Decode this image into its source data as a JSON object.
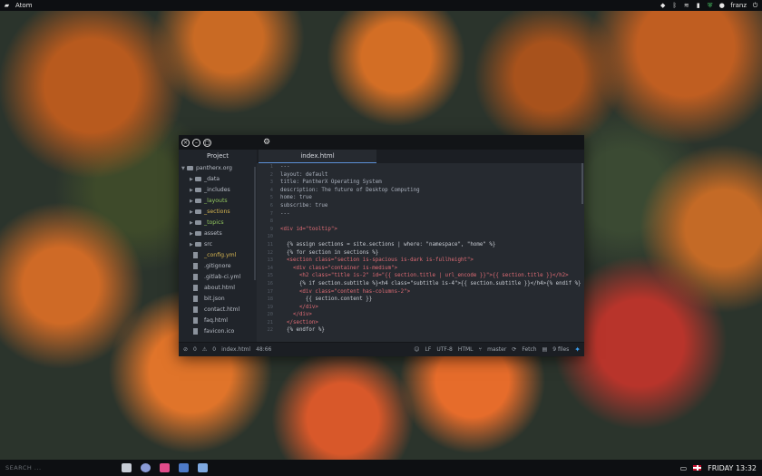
{
  "topbar": {
    "app_name": "Atom",
    "user": "franz",
    "icons": [
      "dropbox-icon",
      "bluetooth-icon",
      "wifi-icon",
      "battery-icon",
      "shield-icon",
      "power-icon"
    ]
  },
  "window": {
    "tabs": {
      "project": "Project",
      "file": "index.html"
    },
    "tree": {
      "root": "pantherx.org",
      "items": [
        {
          "label": "_data",
          "type": "folder",
          "color": "default"
        },
        {
          "label": "_includes",
          "type": "folder",
          "color": "default"
        },
        {
          "label": "_layouts",
          "type": "folder",
          "color": "green"
        },
        {
          "label": "_sections",
          "type": "folder",
          "color": "yellow"
        },
        {
          "label": "_topics",
          "type": "folder",
          "color": "green"
        },
        {
          "label": "assets",
          "type": "folder",
          "color": "default"
        },
        {
          "label": "src",
          "type": "folder",
          "color": "default"
        },
        {
          "label": "_config.yml",
          "type": "file",
          "color": "yellow"
        },
        {
          "label": ".gitignore",
          "type": "file",
          "color": "default"
        },
        {
          "label": ".gitlab-ci.yml",
          "type": "file",
          "color": "default"
        },
        {
          "label": "about.html",
          "type": "file",
          "color": "default"
        },
        {
          "label": "bit.json",
          "type": "file",
          "color": "default"
        },
        {
          "label": "contact.html",
          "type": "file",
          "color": "default"
        },
        {
          "label": "faq.html",
          "type": "file",
          "color": "default"
        },
        {
          "label": "favicon.ico",
          "type": "file",
          "color": "default"
        }
      ]
    },
    "code": {
      "line_numbers": [
        "1",
        "2",
        "3",
        "4",
        "5",
        "6",
        "7",
        "8",
        "9",
        "10",
        "11",
        "12",
        "13",
        "14",
        "15",
        "16",
        "17",
        "18",
        "19",
        "20",
        "21",
        "22"
      ],
      "lines": [
        "---",
        "layout: default",
        "title: PantherX Operating System",
        "description: The future of Desktop Computing",
        "home: true",
        "subscribe: true",
        "---",
        "",
        "<div id=\"tooltip\">",
        "",
        "  {% assign sections = site.sections | where: \"namespace\", \"home\" %}",
        "  {% for section in sections %}",
        "  <section class=\"section is-spacious is-dark is-fullheight\">",
        "    <div class=\"container is-medium\">",
        "      <h2 class=\"title is-2\" id=\"{{ section.title | url_encode }}\">{{ section.title }}</h2>",
        "      {% if section.subtitle %}<h4 class=\"subtitle is-4\">{{ section.subtitle }}</h4>{% endif %}",
        "      <div class=\"content has-columns-2\">",
        "        {{ section.content }}",
        "      </div>",
        "    </div>",
        "  </section>",
        "  {% endfor %}"
      ]
    },
    "status": {
      "errors": "0",
      "warnings": "0",
      "file": "index.html",
      "cursor": "48:66",
      "line_ending": "LF",
      "encoding": "UTF-8",
      "grammar": "HTML",
      "branch": "master",
      "fetch": "Fetch",
      "files": "9 files"
    }
  },
  "taskbar": {
    "search_placeholder": "SEARCH ...",
    "clock": "FRIDAY 13:32"
  }
}
